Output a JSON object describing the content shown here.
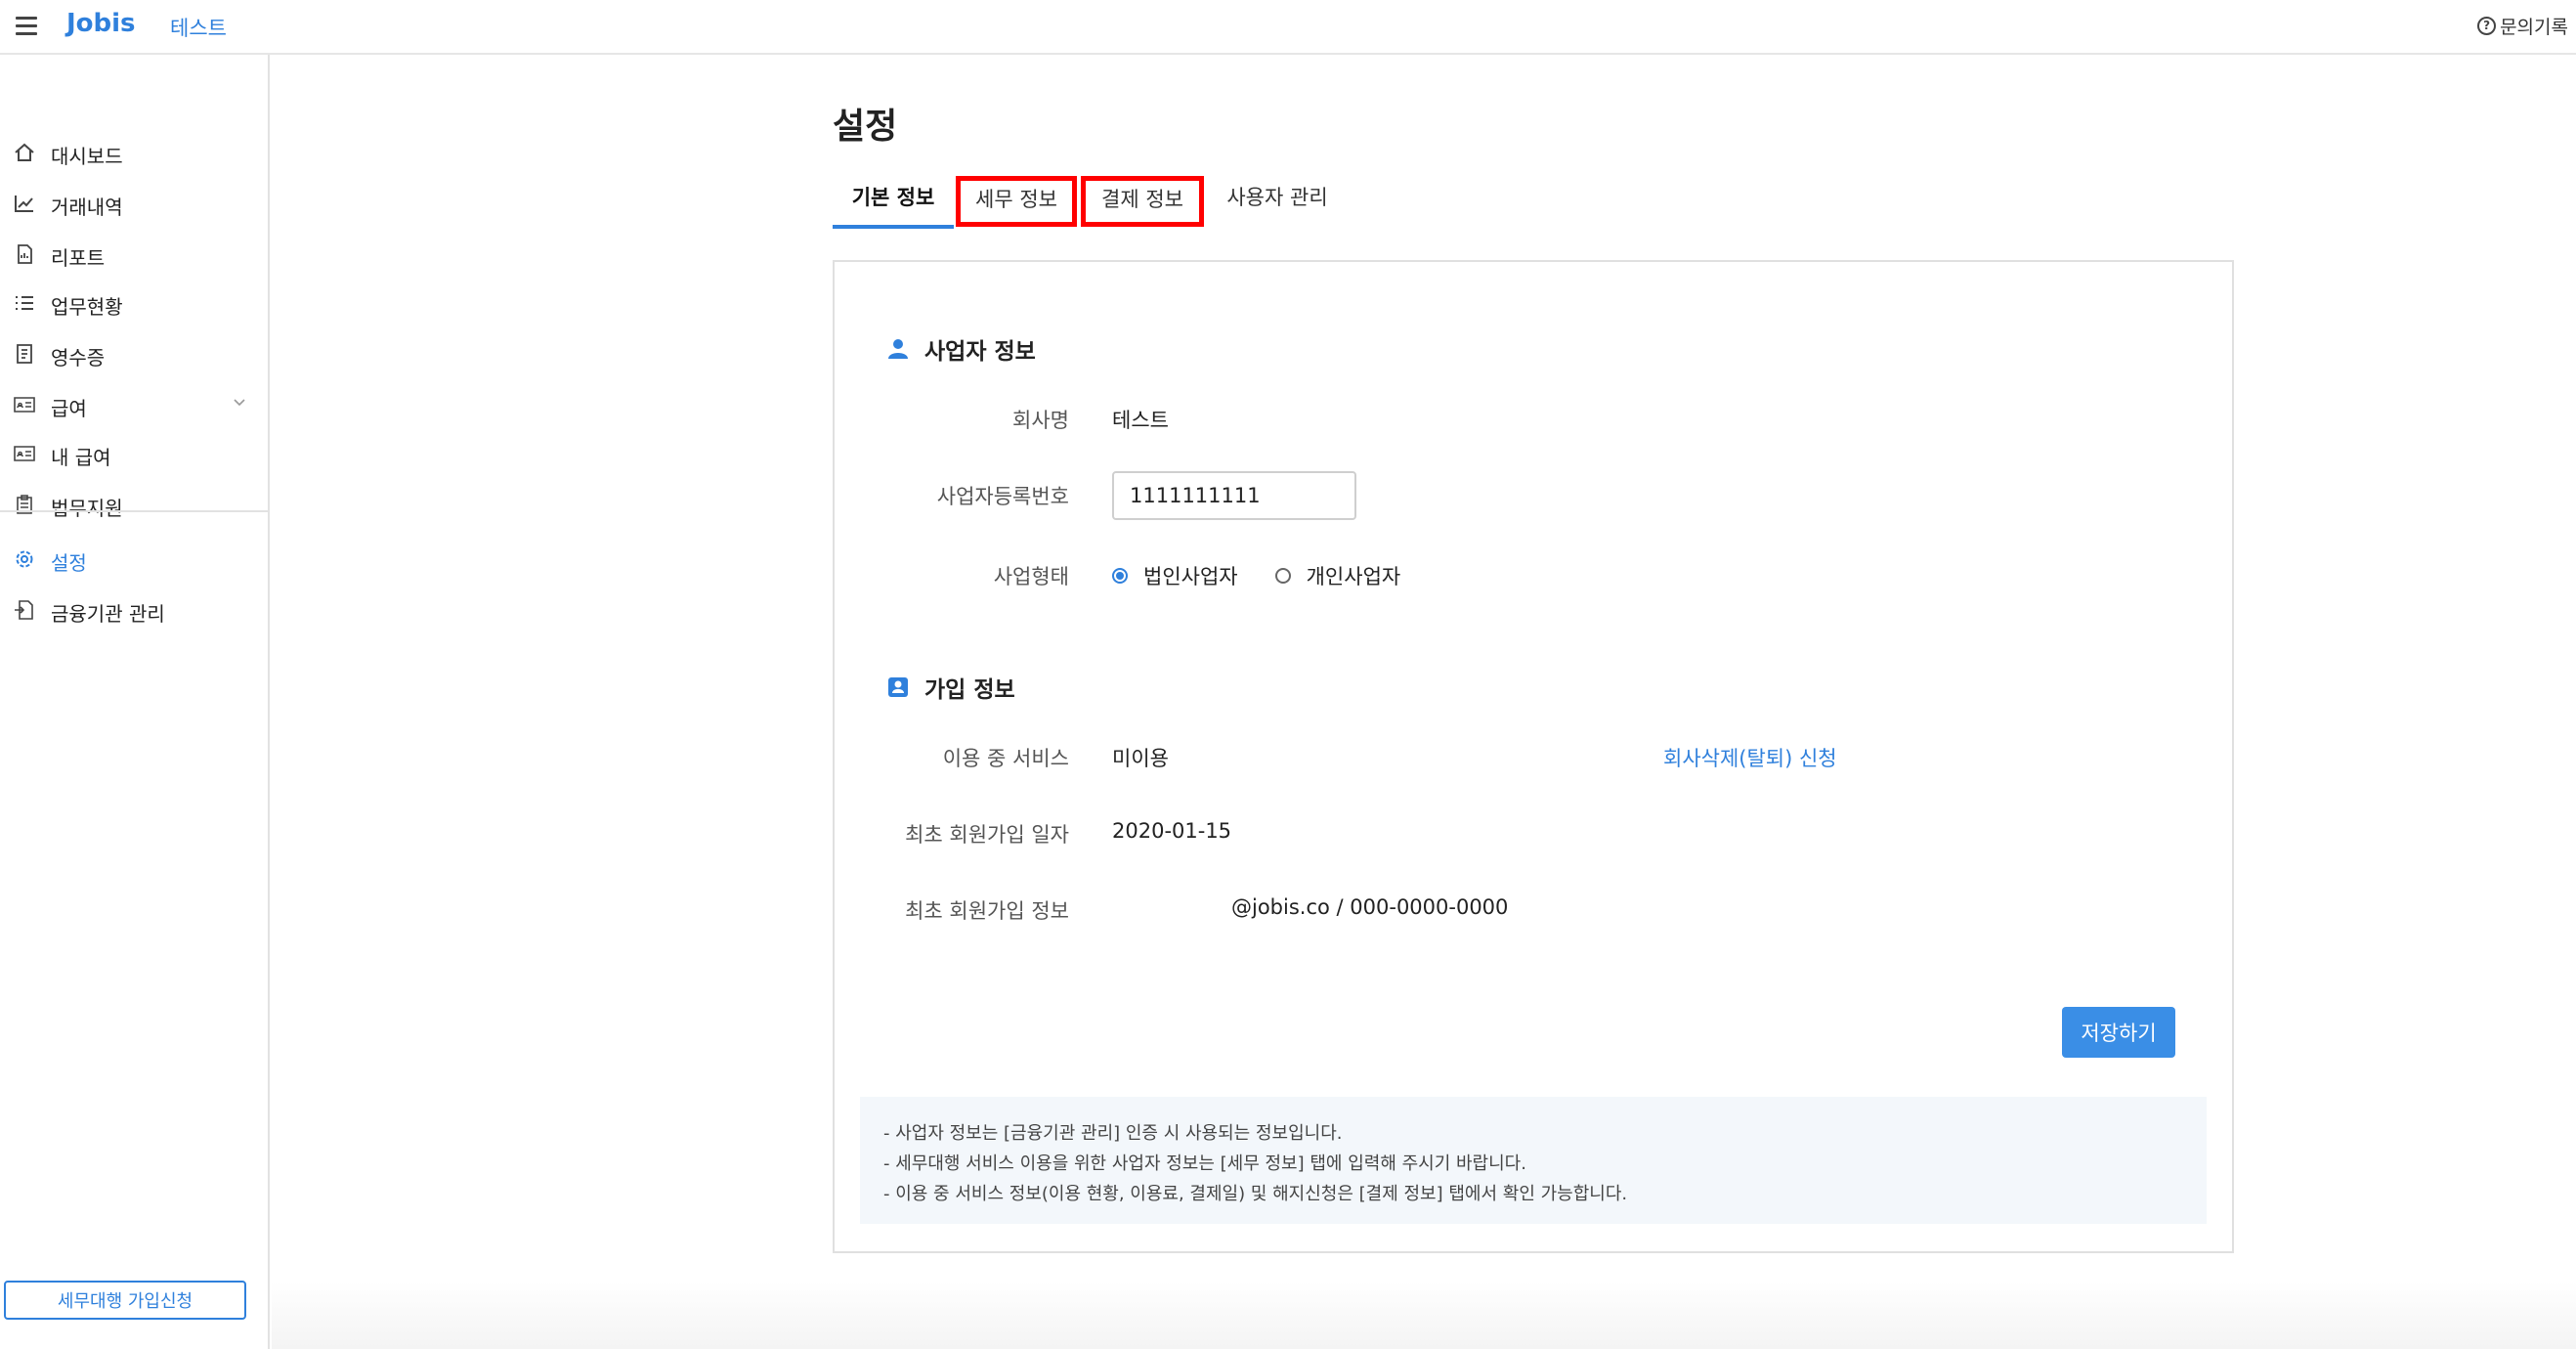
{
  "header": {
    "logo": "Jobis",
    "company": "테스트",
    "inquiry_label": "문의기록"
  },
  "sidebar": {
    "items": [
      {
        "label": "대시보드",
        "icon": "home-icon"
      },
      {
        "label": "거래내역",
        "icon": "chart-line-icon"
      },
      {
        "label": "리포트",
        "icon": "report-icon"
      },
      {
        "label": "업무현황",
        "icon": "checklist-icon"
      },
      {
        "label": "영수증",
        "icon": "receipt-icon"
      },
      {
        "label": "급여",
        "icon": "id-card-icon"
      },
      {
        "label": "내 급여",
        "icon": "id-card-icon"
      },
      {
        "label": "법무지원",
        "icon": "clipboard-icon"
      }
    ],
    "bottom_items": [
      {
        "label": "설정",
        "icon": "gear-icon",
        "active": true
      },
      {
        "label": "금융기관 관리",
        "icon": "document-icon"
      }
    ],
    "apply_button": "세무대행 가입신청"
  },
  "main": {
    "title": "설정",
    "tabs": [
      {
        "label": "기본 정보",
        "active": true
      },
      {
        "label": "세무 정보",
        "highlighted": true
      },
      {
        "label": "결제 정보",
        "highlighted": true
      },
      {
        "label": "사용자 관리"
      }
    ],
    "business_section": {
      "title": "사업자 정보",
      "company_name_label": "회사명",
      "company_name_value": "테스트",
      "reg_no_label": "사업자등록번호",
      "reg_no_value": "1111111111",
      "type_label": "사업형태",
      "type_options": [
        "법인사업자",
        "개인사업자"
      ],
      "type_selected": "법인사업자"
    },
    "signup_section": {
      "title": "가입 정보",
      "service_label": "이용 중 서비스",
      "service_value": "미이용",
      "withdraw_link": "회사삭제(탈퇴) 신청",
      "first_date_label": "최초 회원가입 일자",
      "first_date_value": "2020-01-15",
      "first_info_label": "최초 회원가입 정보",
      "first_info_value": "@jobis.co / 000-0000-0000"
    },
    "save_button": "저장하기",
    "notice": [
      "- 사업자 정보는 [금융기관 관리] 인증 시 사용되는 정보입니다.",
      "- 세무대행 서비스 이용을 위한 사업자 정보는 [세무 정보] 탭에 입력해 주시기 바랍니다.",
      "- 이용 중 서비스 정보(이용 현황, 이용료, 결제일) 및 해지신청은 [결제 정보] 탭에서 확인 가능합니다."
    ]
  },
  "colors": {
    "accent": "#2f80dc",
    "highlight": "#ff0000",
    "notice_bg": "#f3f7fb"
  }
}
